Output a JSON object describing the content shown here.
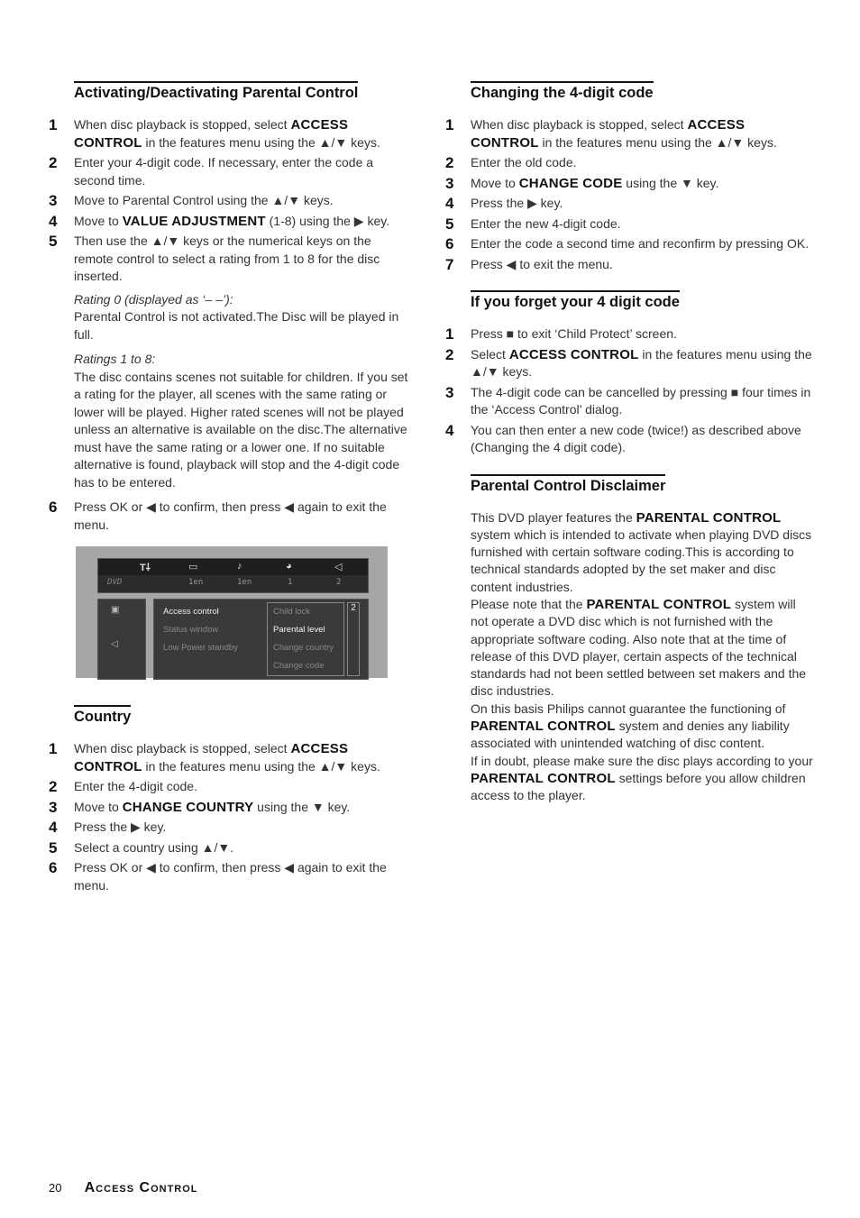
{
  "left_column": {
    "section1": {
      "title": "Activating/Deactivating Parental Control",
      "steps": [
        {
          "num": "1",
          "pre": "When disc playback is stopped, select ",
          "bold": "ACCESS CONTROL",
          "post": " in the features menu using the ▲/▼ keys."
        },
        {
          "num": "2",
          "text": "Enter your 4-digit code. If necessary, enter the code a second time."
        },
        {
          "num": "3",
          "text": "Move to Parental Control using the ▲/▼ keys."
        },
        {
          "num": "4",
          "pre": "Move to ",
          "bold": "VALUE ADJUSTMENT",
          "post": " (1-8) using the ▶ key."
        },
        {
          "num": "5",
          "text": "Then use the ▲/▼ keys or the numerical keys on the remote control to select a rating from 1 to 8 for the disc inserted."
        }
      ],
      "note1_title": "Rating 0 (displayed as ‘– –’):",
      "note1_text": "Parental Control is not activated.The Disc will be played in full.",
      "note2_title": "Ratings 1 to 8:",
      "note2_text": "The disc contains scenes not suitable for children. If you set a rating for the player, all scenes with the same rating or lower will be played. Higher rated scenes will not be played unless an alternative is available on the disc.The alternative must have the same rating or a lower one. If no suitable alternative is found, playback will stop and the 4-digit code has to be entered.",
      "step6": {
        "num": "6",
        "text": "Press OK or ◀ to confirm, then press ◀ again to exit the menu."
      }
    },
    "screen": {
      "top_icons": [
        "tools-icon",
        "subtitle-icon",
        "audio-icon",
        "angle-icon",
        "speaker-icon"
      ],
      "dvd_label": "DVD",
      "values": [
        "1en",
        "1en",
        "1",
        "2"
      ],
      "menu": [
        "Access control",
        "Status window",
        "Low Power standby"
      ],
      "submenu": [
        "Child lock",
        "Parental level",
        "Change country",
        "Change code"
      ],
      "level": "2"
    },
    "section2": {
      "title": "Country",
      "steps": [
        {
          "num": "1",
          "pre": "When disc playback is stopped, select ",
          "bold": "ACCESS CONTROL",
          "post": " in the features menu using the ▲/▼ keys."
        },
        {
          "num": "2",
          "text": "Enter the 4-digit code."
        },
        {
          "num": "3",
          "pre": "Move to ",
          "bold": "CHANGE COUNTRY",
          "post": " using the ▼ key."
        },
        {
          "num": "4",
          "text": "Press the ▶ key."
        },
        {
          "num": "5",
          "text": "Select a country using ▲/▼."
        },
        {
          "num": "6",
          "text": "Press OK or ◀ to confirm, then press ◀ again to exit the menu."
        }
      ]
    }
  },
  "right_column": {
    "section1": {
      "title": "Changing the 4-digit code",
      "steps": [
        {
          "num": "1",
          "pre": "When disc playback is stopped, select ",
          "bold": "ACCESS CONTROL",
          "post": " in the features menu using the ▲/▼ keys."
        },
        {
          "num": "2",
          "text": "Enter the old code."
        },
        {
          "num": "3",
          "pre": "Move to ",
          "bold": "CHANGE CODE",
          "post": " using the ▼ key."
        },
        {
          "num": "4",
          "text": "Press the ▶ key."
        },
        {
          "num": "5",
          "text": "Enter the new 4-digit code."
        },
        {
          "num": "6",
          "text": "Enter the code a second time and reconfirm by pressing OK."
        },
        {
          "num": "7",
          "text": "Press ◀ to exit the menu."
        }
      ]
    },
    "section2": {
      "title": "If you forget your 4 digit code",
      "steps": [
        {
          "num": "1",
          "text": "Press ■ to exit ‘Child Protect’ screen."
        },
        {
          "num": "2",
          "pre": "Select ",
          "bold": "ACCESS CONTROL",
          "post": " in the features menu using the ▲/▼ keys."
        },
        {
          "num": "3",
          "text": "The 4-digit code can be cancelled by pressing ■ four times in the ‘Access Control’ dialog."
        },
        {
          "num": "4",
          "text": "You can then enter a new code (twice!) as described above (Changing the 4 digit code)."
        }
      ]
    },
    "section3": {
      "title": "Parental Control Disclaimer",
      "p1_pre": "This DVD player features the ",
      "p1_bold": "PARENTAL CONTROL",
      "p1_post": " system which is intended to activate when playing DVD discs furnished with certain software coding.This is according to technical standards adopted by the set maker and disc content industries.",
      "p2_pre": "Please note that the ",
      "p2_bold": "PARENTAL CONTROL",
      "p2_post": " system will not operate a DVD disc which is not furnished with the appropriate software coding. Also note that at the time of release of this DVD player, certain aspects of the technical standards had not been settled between set makers and the disc industries.",
      "p3_pre": "On this basis Philips cannot guarantee the functioning of ",
      "p3_bold": "PARENTAL CONTROL",
      "p3_post": " system and denies any liability associated with unintended watching of disc content.",
      "p4_pre": "If in doubt, please make sure the disc plays according to your ",
      "p4_bold": "PARENTAL CONTROL",
      "p4_post": " settings before you allow children access to the player."
    }
  },
  "footer": {
    "page_number": "20",
    "section_title": "Access Control"
  }
}
